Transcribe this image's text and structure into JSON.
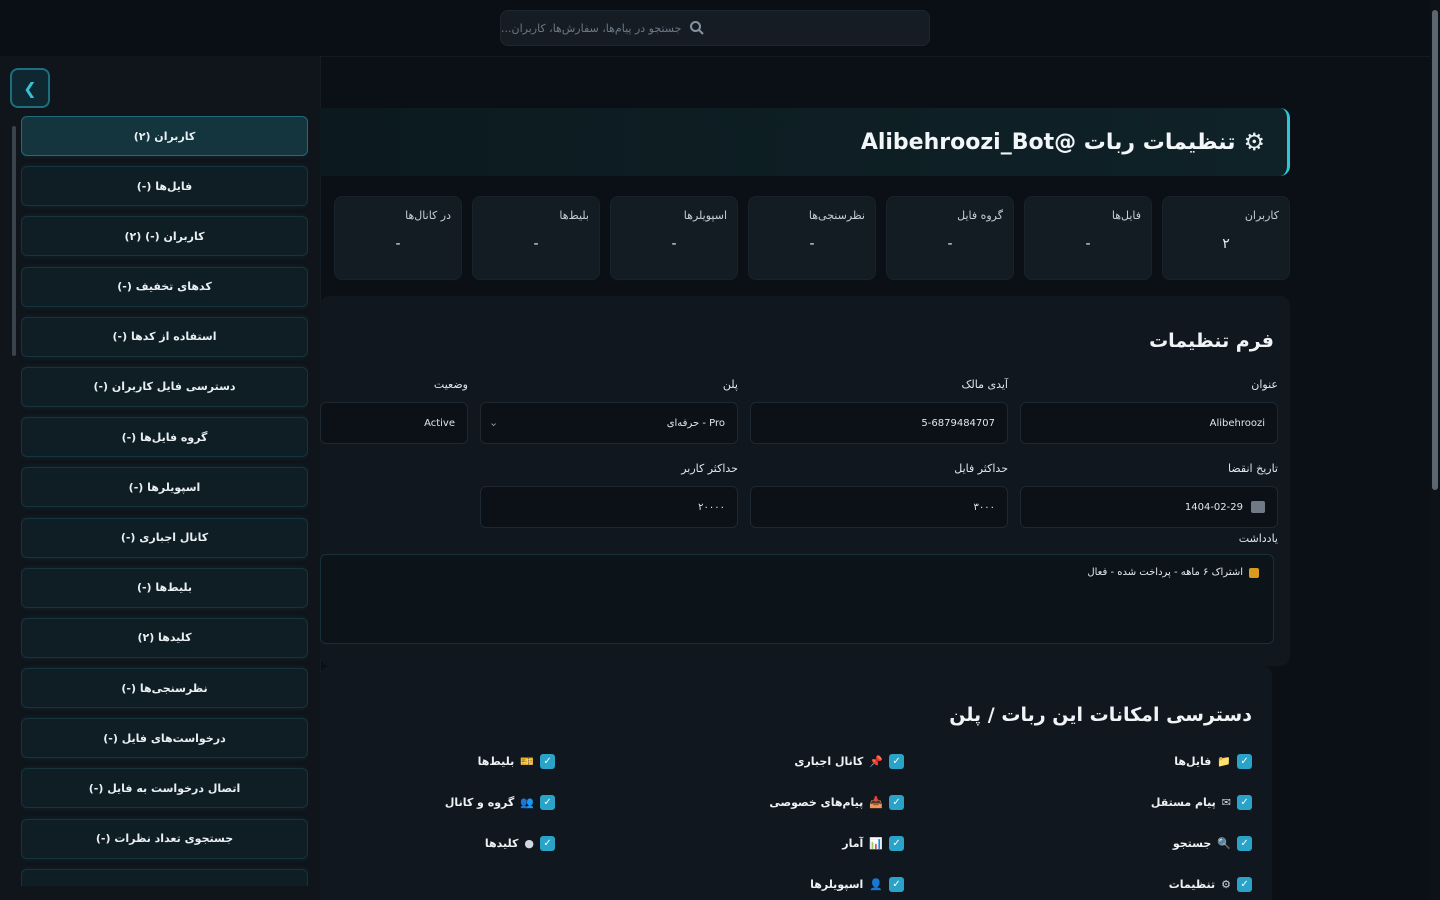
{
  "search": {
    "placeholder": "جستجو در پیام‌ها، سفارش‌ها، کاربران..."
  },
  "sidebar": {
    "collapse_icon": "chevron-left-icon",
    "items": [
      "کاربران (۲)",
      "فایل‌ها (-)",
      "کاربران (-) (۲)",
      "کدهای تخفیف (-)",
      "استفاده از کدها (-)",
      "دسترسی فایل کاربران (-)",
      "گروه فایل‌ها (-)",
      "اسپویلرها (-)",
      "کانال اجباری (-)",
      "بلیط‌ها (-)",
      "کلیدها (۲)",
      "نظرسنجی‌ها (-)",
      "درخواست‌های فایل (-)",
      "اتصال درخواست به فایل (-)",
      "جستجوی تعداد نظرات (-)",
      "..."
    ]
  },
  "header": {
    "title": "تنظیمات ربات @Alibehroozi_Bot"
  },
  "stats": [
    {
      "label": "کاربران",
      "value": "۲"
    },
    {
      "label": "فایل‌ها",
      "value": "-"
    },
    {
      "label": "گروه فایل",
      "value": "-"
    },
    {
      "label": "نظرسنجی‌ها",
      "value": "-"
    },
    {
      "label": "اسپویلرها",
      "value": "-"
    },
    {
      "label": "بلیط‌ها",
      "value": "-"
    },
    {
      "label": "در کانال‌ها",
      "value": "-"
    }
  ],
  "form": {
    "title": "فرم تنظیمات",
    "fields": {
      "name": {
        "label": "عنوان",
        "value": "Alibehroozi"
      },
      "owner_id": {
        "label": "آیدی مالک",
        "value": "5-6879484707"
      },
      "plan": {
        "label": "پلن",
        "value": "حرفه‌ای - Pro"
      },
      "status": {
        "label": "وضعیت",
        "value": "Active"
      },
      "expiry": {
        "label": "تاریخ انقضا",
        "value": "1404-02-29"
      },
      "max_files": {
        "label": "حداکثر فایل",
        "value": "۳۰۰۰"
      },
      "max_users": {
        "label": "حداکثر کاربر",
        "value": "۲۰۰۰۰"
      }
    },
    "notes_label": "یادداشت",
    "notes_text": "اشتراک ۶ ماهه - پرداخت شده - فعال"
  },
  "access": {
    "title": "دسترسی امکانات این ربات / پلن",
    "features": [
      {
        "label": "فایل‌ها",
        "icon": "folder-icon"
      },
      {
        "label": "کانال اجباری",
        "icon": "pin-icon"
      },
      {
        "label": "بلیط‌ها",
        "icon": "ticket-icon"
      },
      {
        "label": "پیام مستقل",
        "icon": "message-icon"
      },
      {
        "label": "پیام‌های خصوصی",
        "icon": "inbox-icon"
      },
      {
        "label": "گروه و کانال",
        "icon": "group-icon"
      },
      {
        "label": "جستجو",
        "icon": "search-icon"
      },
      {
        "label": "آمار",
        "icon": "stats-icon"
      },
      {
        "label": "کلیدها",
        "icon": "circle-icon"
      },
      {
        "label": "تنظیمات",
        "icon": "gear-icon"
      },
      {
        "label": "اسپویلرها",
        "icon": "user-icon"
      }
    ]
  }
}
